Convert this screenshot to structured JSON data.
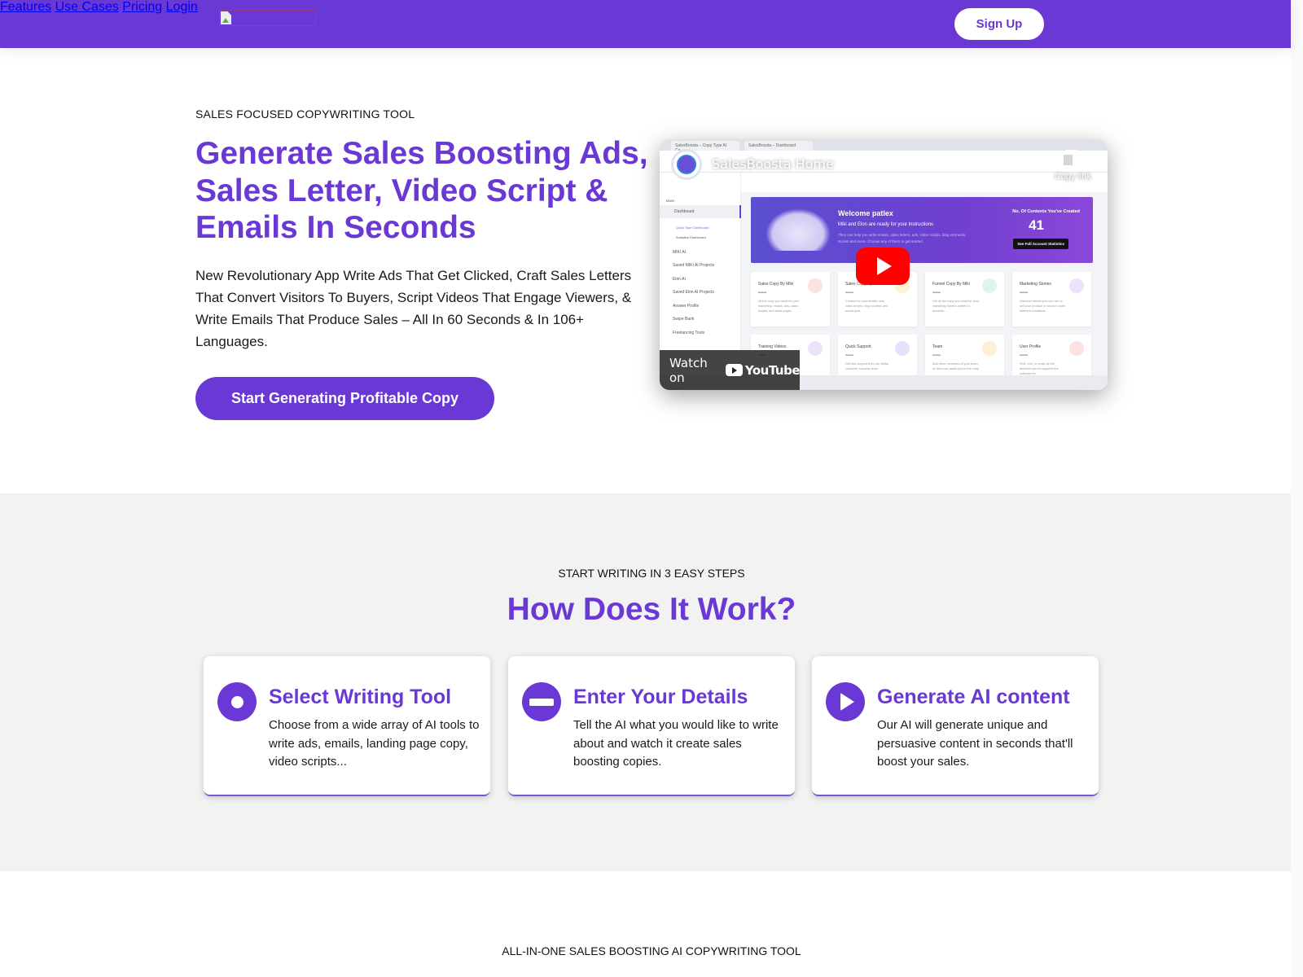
{
  "header": {
    "logo_alt": "",
    "nav": [
      "Features",
      "Use Cases",
      "Pricing",
      "Login"
    ],
    "signup_label": "Sign Up",
    "brand_color": "#6a38d4"
  },
  "hero": {
    "eyebrow": "SALES FOCUSED COPYWRITING TOOL",
    "title": "Generate Sales Boosting Ads, Sales Letter, Video Script & Emails In Seconds",
    "description": "New Revolutionary App Write Ads That Get Clicked, Craft Sales Letters That Convert Visitors To Buyers, Script Videos That Engage Viewers, & Write Emails That Produce Sales – All In 60 Seconds & In 106+ Languages.",
    "cta_label": "Start Generating Profitable Copy"
  },
  "video": {
    "title": "SalesBoosta Home",
    "copy_link_label": "Copy link",
    "watch_on_label": "Watch on",
    "youtube_label": "YouTube",
    "browser_tabs": [
      "SalesBoosta – Copy Type AI Co...",
      "SalesBoosta – Dashboard"
    ],
    "sidebar_items": [
      "MAIN",
      "Dashboard",
      "Quick Start Dashboard",
      "Analytics Dashboard",
      "MIKI AI",
      "Saved MIKI AI Projects",
      "Elon AI",
      "Saved Elon AI Projects",
      "Answer Profile",
      "Swipe Bank",
      "Freelancing Tools"
    ],
    "banner": {
      "welcome": "Welcome patlex",
      "subtitle": "Miki and Elon are ready for your instructions",
      "description": "They can help you write emails, sales letters, ads, video scripts, blog elements, stories and more. Choose any of them to get started.",
      "count_label": "No. Of Contents You've Created",
      "count": "41",
      "stats_button": "See Full Account Statistics"
    },
    "cards": [
      {
        "title": "Sales Copy By Miki",
        "value": "-----",
        "desc": "All the copy you need for your marketing: emails, ads, video scripts, and sales pages",
        "color": "#fde2e2"
      },
      {
        "title": "Sales Copy By Elon",
        "value": "-----",
        "desc": "Content for your emails, ads, video scripts, blog content, and social post.",
        "color": "#fdf0d5"
      },
      {
        "title": "Funnel Copy By Miki",
        "value": "-----",
        "desc": "Get all the copy you need for your marketing funnels written in seconds",
        "color": "#dcf7e8"
      },
      {
        "title": "Marketing Stories",
        "value": "-----",
        "desc": "Discover stories you can use to sell your product or service under different conditions",
        "color": "#ece3fb"
      },
      {
        "title": "Training Videos",
        "value": "-----",
        "desc": "",
        "color": "#ece3fb"
      },
      {
        "title": "Quick Support",
        "value": "-----",
        "desc": "Get fast support from our stellar customer success team",
        "color": "#e6e0fb"
      },
      {
        "title": "Team",
        "value": "-----",
        "desc": "Add other members of your team, so they can assist you in the copy",
        "color": "#fdf0d5"
      },
      {
        "title": "User Profile",
        "value": "-----",
        "desc": "Find, edit, or reuse all the answers you've supplied the software for",
        "color": "#fde2e2"
      }
    ]
  },
  "steps": {
    "eyebrow": "START WRITING IN 3 EASY STEPS",
    "title": "How Does It Work?",
    "items": [
      {
        "icon": "record-icon",
        "title": "Select Writing Tool",
        "description": "Choose from a wide array of AI tools to write ads, emails, landing page copy, video scripts..."
      },
      {
        "icon": "minus-circle-icon",
        "title": "Enter Your Details",
        "description": "Tell the AI what you would like to write about and watch it create sales boosting copies."
      },
      {
        "icon": "play-circle-icon",
        "title": "Generate AI content",
        "description": "Our AI will generate unique and persuasive content in seconds that'll boost your sales."
      }
    ]
  },
  "next_section": {
    "eyebrow": "ALL-IN-ONE SALES BOOSTING AI COPYWRITING TOOL"
  }
}
